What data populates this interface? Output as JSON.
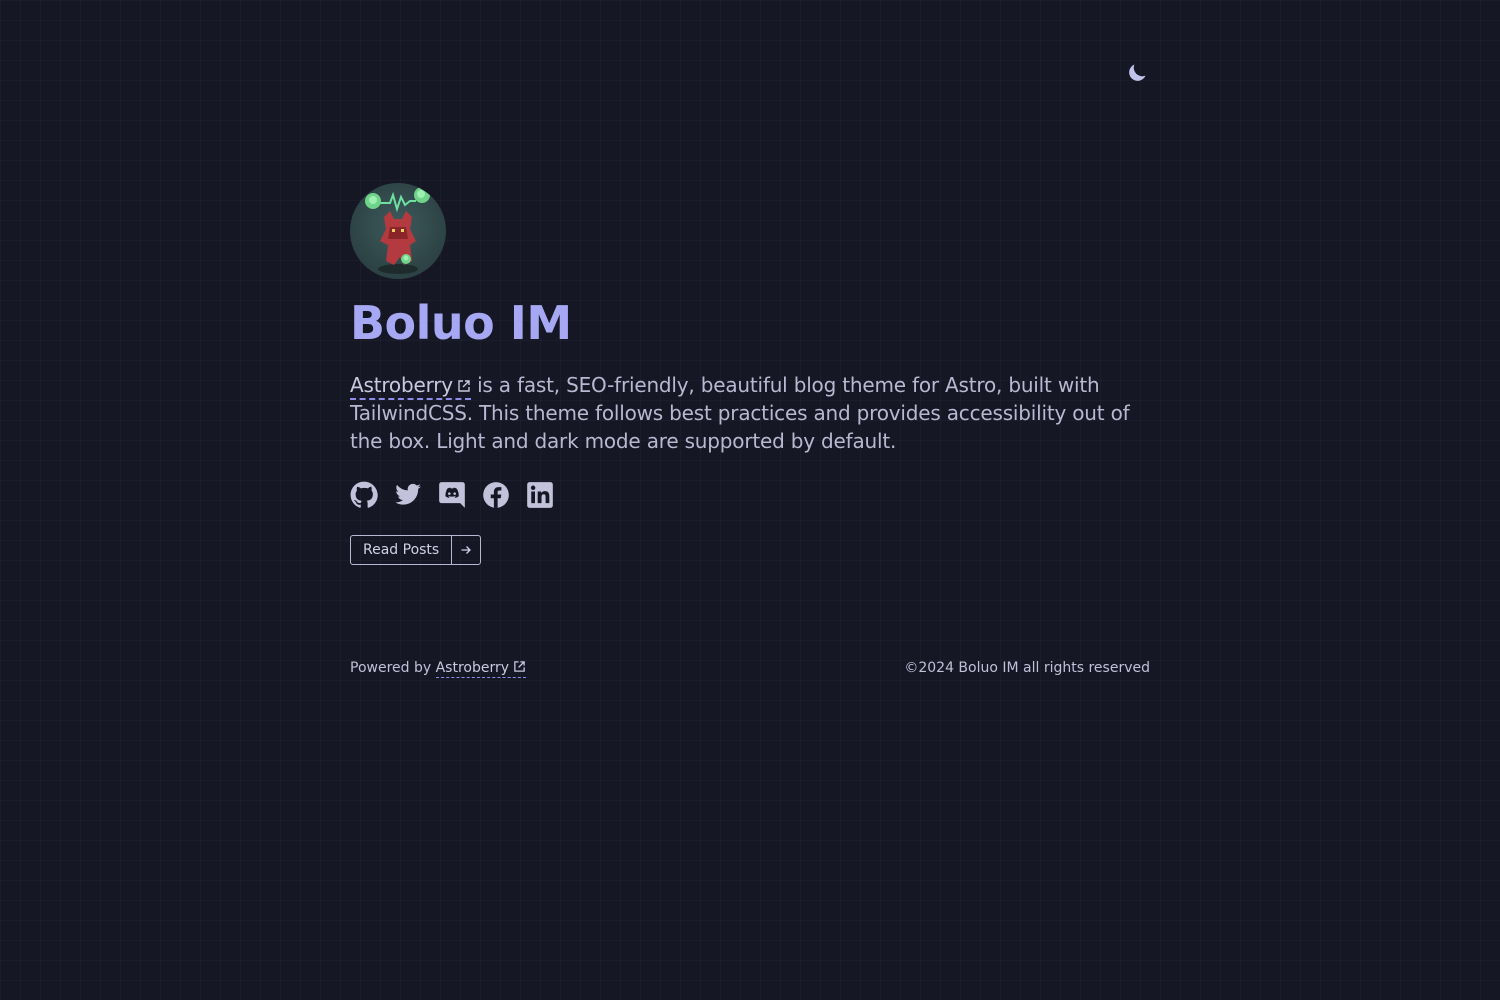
{
  "header": {
    "theme_toggle_icon": "moon-icon"
  },
  "profile": {
    "avatar_icon": "pixel-creature-avatar",
    "title": "Boluo IM"
  },
  "intro": {
    "link_text": "Astroberry",
    "text": " is a fast, SEO-friendly, beautiful blog theme for Astro, built with TailwindCSS. This theme follows best practices and provides accessibility out of the box. Light and dark mode are supported by default."
  },
  "socials": [
    {
      "name": "GitHub",
      "icon": "github-icon"
    },
    {
      "name": "Twitter",
      "icon": "twitter-icon"
    },
    {
      "name": "Discord",
      "icon": "discord-icon"
    },
    {
      "name": "Facebook",
      "icon": "facebook-icon"
    },
    {
      "name": "LinkedIn",
      "icon": "linkedin-icon"
    }
  ],
  "cta": {
    "label": "Read Posts",
    "icon": "arrow-right-icon"
  },
  "footer": {
    "powered_prefix": "Powered by ",
    "powered_link": "Astroberry",
    "copyright": "©2024 Boluo IM all rights reserved"
  },
  "colors": {
    "background": "#161725",
    "accent": "#a6a8f4",
    "text": "#b8b9d0",
    "link_underline": "#8b8de6"
  }
}
